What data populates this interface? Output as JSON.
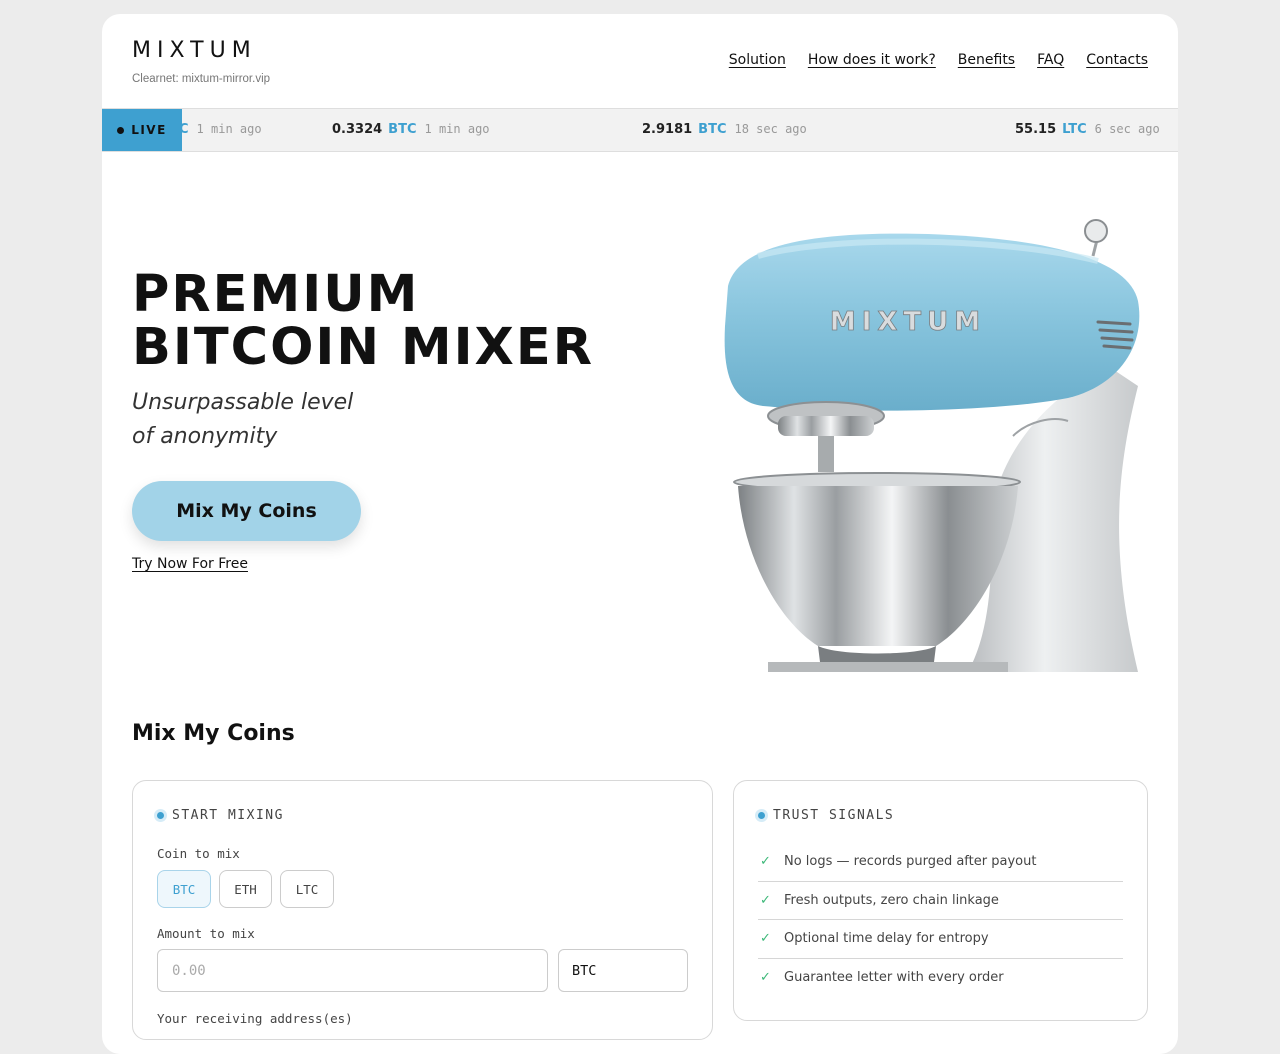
{
  "header": {
    "brand": "MIXTUM",
    "clearnet": "Clearnet: mixtum-mirror.vip",
    "nav": [
      "Solution",
      "How does it work?",
      "Benefits",
      "FAQ",
      "Contacts"
    ]
  },
  "ticker": {
    "live_label": "LIVE",
    "items": [
      {
        "amount": "",
        "currency": "LTC",
        "ago": "1 min ago"
      },
      {
        "amount": "0.3324",
        "currency": "BTC",
        "ago": "1 min ago"
      },
      {
        "amount": "2.9181",
        "currency": "BTC",
        "ago": "18 sec ago"
      },
      {
        "amount": "55.15",
        "currency": "LTC",
        "ago": "6 sec ago"
      }
    ]
  },
  "hero": {
    "title_line1": "PREMIUM",
    "title_line2": "BITCOIN MIXER",
    "subtitle_line1": "Unsurpassable level",
    "subtitle_line2": "of anonymity",
    "cta": "Mix My Coins",
    "try_link": "Try Now For Free",
    "mixer_brand": "MIXTUM"
  },
  "mix": {
    "section_title": "Mix My Coins",
    "start": {
      "heading": "START MIXING",
      "coin_label": "Coin to mix",
      "coins": [
        "BTC",
        "ETH",
        "LTC"
      ],
      "selected_coin": "BTC",
      "amount_label": "Amount to mix",
      "amount_placeholder": "0.00",
      "amount_unit": "BTC",
      "address_label": "Your receiving address(es)"
    },
    "trust": {
      "heading": "TRUST SIGNALS",
      "items": [
        "No logs — records purged after payout",
        "Fresh outputs, zero chain linkage",
        "Optional time delay for entropy",
        "Guarantee letter with every order"
      ]
    }
  },
  "colors": {
    "accent": "#3ea0d0",
    "cta_bg": "#a2d3e8",
    "check": "#3cb878",
    "mixer_body": "#8ec8df"
  }
}
